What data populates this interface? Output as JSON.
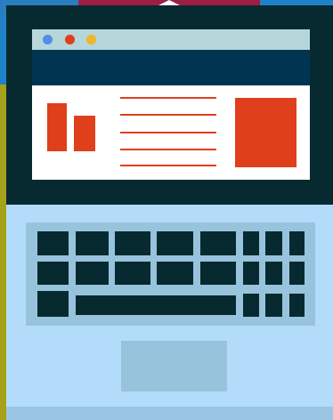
{
  "illustration": {
    "subject": "",
    "palette": {
      "background": "#1f82c8",
      "lid": "#062a30",
      "screen": "#ffffff",
      "browser_bar": "#b6d6db",
      "header_band": "#003552",
      "accent": "#e03f1b",
      "base": "#b3dcfb",
      "keyboard": "#98c3dc"
    },
    "browser_dots": [
      "blue",
      "red",
      "yellow"
    ],
    "keyboard_rows": 3,
    "keys_per_row": [
      8,
      8,
      5
    ]
  }
}
